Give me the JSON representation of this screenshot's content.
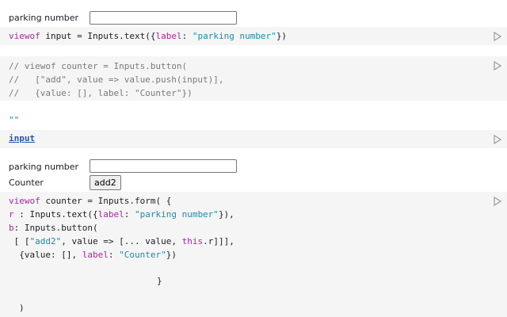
{
  "cell1": {
    "input_label": "parking number",
    "input_value": "",
    "code": {
      "viewof": "viewof",
      "name": " input",
      "eq": " = ",
      "call": "Inputs.text({",
      "prop": "label",
      "colon": ": ",
      "str": "\"parking number\"",
      "close": "})"
    }
  },
  "cell2": {
    "lines": [
      "// viewof counter = Inputs.button(",
      "//   [\"add\", value => value.push(input)],",
      "//   {value: [], label: \"Counter\"})"
    ]
  },
  "cell3": {
    "output": "\"\""
  },
  "cell4": {
    "var": "input"
  },
  "cell5": {
    "input_label": "parking number",
    "input_value": "",
    "counter_label": "Counter",
    "button_label": "add2",
    "code": {
      "l1_viewof": "viewof",
      "l1_rest": " counter = Inputs.form( {",
      "l2_key": "r",
      "l2_mid": " : Inputs.text({",
      "l2_prop": "label",
      "l2_colon": ": ",
      "l2_str": "\"parking number\"",
      "l2_end": "}),",
      "l3_key": "b",
      "l3_rest": ": Inputs.button(",
      "l4_a": " [ [",
      "l4_str": "\"add2\"",
      "l4_b": ", value => [... value, ",
      "l4_this": "this",
      "l4_c": ".r]]],",
      "l5_a": "  {value: [], ",
      "l5_prop": "label",
      "l5_colon": ": ",
      "l5_str": "\"Counter\"",
      "l5_end": "})",
      "l6": "}",
      "l7": ")"
    }
  }
}
